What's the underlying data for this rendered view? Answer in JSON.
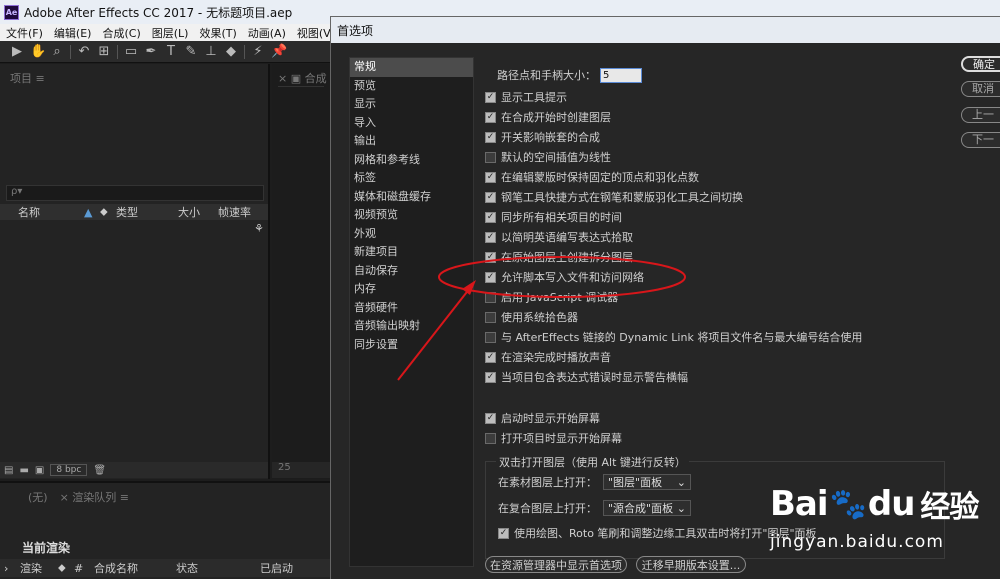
{
  "ae_window": {
    "title": "Adobe After Effects CC 2017 - 无标题项目.aep",
    "menu": [
      "文件(F)",
      "编辑(E)",
      "合成(C)",
      "图层(L)",
      "效果(T)",
      "动画(A)",
      "视图(V)",
      "窗"
    ],
    "project_panel": {
      "title": "项目 ≡",
      "search_placeholder": "ρ▾",
      "columns": [
        "名称",
        "类型",
        "大小",
        "帧速率"
      ],
      "bpc": "8 bpc"
    },
    "comp_panel": {
      "tab": "× ▣ 合成",
      "footer": "25"
    },
    "render_panel": {
      "tabs": [
        "(无)",
        "× 渲染队列 ≡"
      ],
      "current_render": "当前渲染",
      "columns": [
        "渲染",
        "#",
        "合成名称",
        "状态",
        "已启动"
      ]
    }
  },
  "dialog": {
    "title": "首选项",
    "categories": [
      "常规",
      "预览",
      "显示",
      "导入",
      "输出",
      "网格和参考线",
      "标签",
      "媒体和磁盘缓存",
      "视频预览",
      "外观",
      "新建项目",
      "自动保存",
      "内存",
      "音频硬件",
      "音频输出映射",
      "同步设置"
    ],
    "selected_category": "常规",
    "handle_size_label": "路径点和手柄大小：",
    "handle_size_value": "5",
    "options": [
      {
        "label": "显示工具提示",
        "checked": true
      },
      {
        "label": "在合成开始时创建图层",
        "checked": true
      },
      {
        "label": "开关影响嵌套的合成",
        "checked": true
      },
      {
        "label": "默认的空间插值为线性",
        "checked": false
      },
      {
        "label": "在编辑蒙版时保持固定的顶点和羽化点数",
        "checked": true
      },
      {
        "label": "钢笔工具快捷方式在钢笔和蒙版羽化工具之间切换",
        "checked": true
      },
      {
        "label": "同步所有相关项目的时间",
        "checked": true
      },
      {
        "label": "以简明英语编写表达式拾取",
        "checked": true
      },
      {
        "label": "在原始图层上创建拆分图层",
        "checked": true
      },
      {
        "label": "允许脚本写入文件和访问网络",
        "checked": true
      },
      {
        "label": "启用 JavaScript 调试器",
        "checked": false
      },
      {
        "label": "使用系统拾色器",
        "checked": false
      },
      {
        "label": "与 AfterEffects 链接的 Dynamic Link 将项目文件名与最大编号结合使用",
        "checked": false
      },
      {
        "label": "在渲染完成时播放声音",
        "checked": true
      },
      {
        "label": "当项目包含表达式错误时显示警告横幅",
        "checked": true
      }
    ],
    "startup_options": [
      {
        "label": "启动时显示开始屏幕",
        "checked": true
      },
      {
        "label": "打开项目时显示开始屏幕",
        "checked": false
      }
    ],
    "dblclick_group": {
      "legend": "双击打开图层（使用 Alt 键进行反转）",
      "footage_label": "在素材图层上打开：",
      "footage_value": "\"图层\"面板",
      "comp_label": "在复合图层上打开：",
      "comp_value": "\"源合成\"面板",
      "roto_label": "使用绘图、Roto 笔刷和调整边缘工具双击时将打开\"图层\"面板",
      "roto_checked": true
    },
    "bottom_buttons": [
      "在资源管理器中显示首选项",
      "迁移早期版本设置..."
    ],
    "side_buttons": [
      "确定",
      "取消",
      "上一",
      "下一"
    ]
  },
  "watermark": {
    "logo_a": "Bai",
    "logo_b": "du",
    "brand": "经验",
    "url": "jingyan.baidu.com"
  },
  "colors": {
    "annotation": "#d8161a",
    "selected": "#4c4c4c"
  }
}
